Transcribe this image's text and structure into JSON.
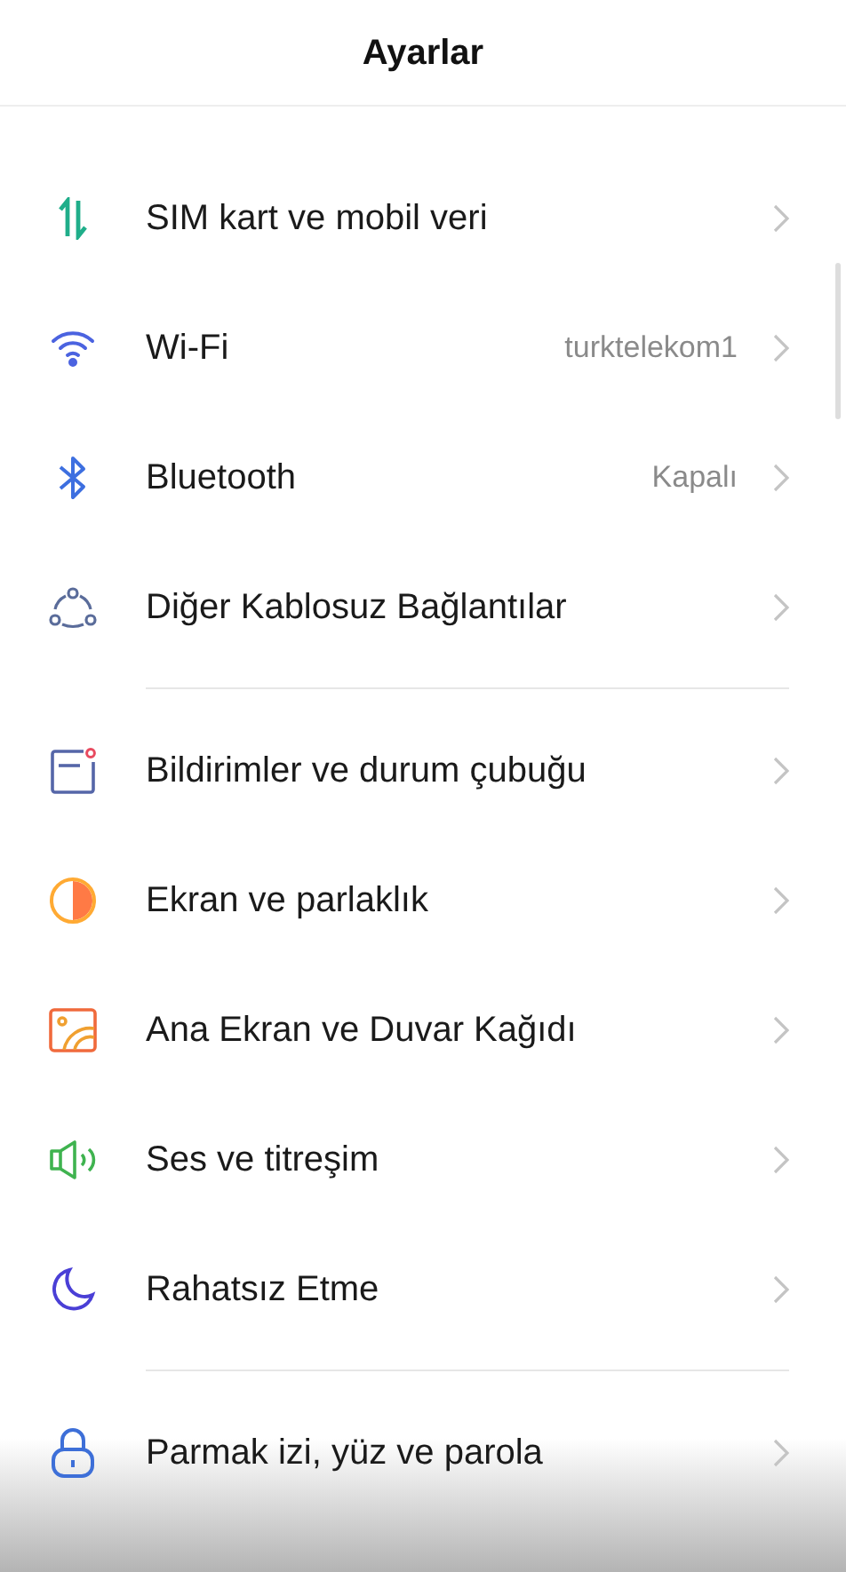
{
  "header": {
    "title": "Ayarlar"
  },
  "sections": [
    {
      "items": [
        {
          "kind": "updown",
          "label": "SIM kart ve mobil veri"
        },
        {
          "kind": "wifi",
          "label": "Wi-Fi",
          "value": "turktelekom1"
        },
        {
          "kind": "bluetooth",
          "label": "Bluetooth",
          "value": "Kapalı"
        },
        {
          "kind": "nodes",
          "label": "Diğer Kablosuz Bağlantılar"
        }
      ]
    },
    {
      "items": [
        {
          "kind": "notify",
          "label": "Bildirimler ve durum çubuğu"
        },
        {
          "kind": "display",
          "label": "Ekran ve parlaklık"
        },
        {
          "kind": "wallpaper",
          "label": "Ana Ekran ve Duvar Kağıdı"
        },
        {
          "kind": "sound",
          "label": "Ses ve titreşim"
        },
        {
          "kind": "moon",
          "label": "Rahatsız Etme"
        }
      ]
    },
    {
      "items": [
        {
          "kind": "lock",
          "label": "Parmak izi, yüz ve parola"
        }
      ]
    }
  ]
}
